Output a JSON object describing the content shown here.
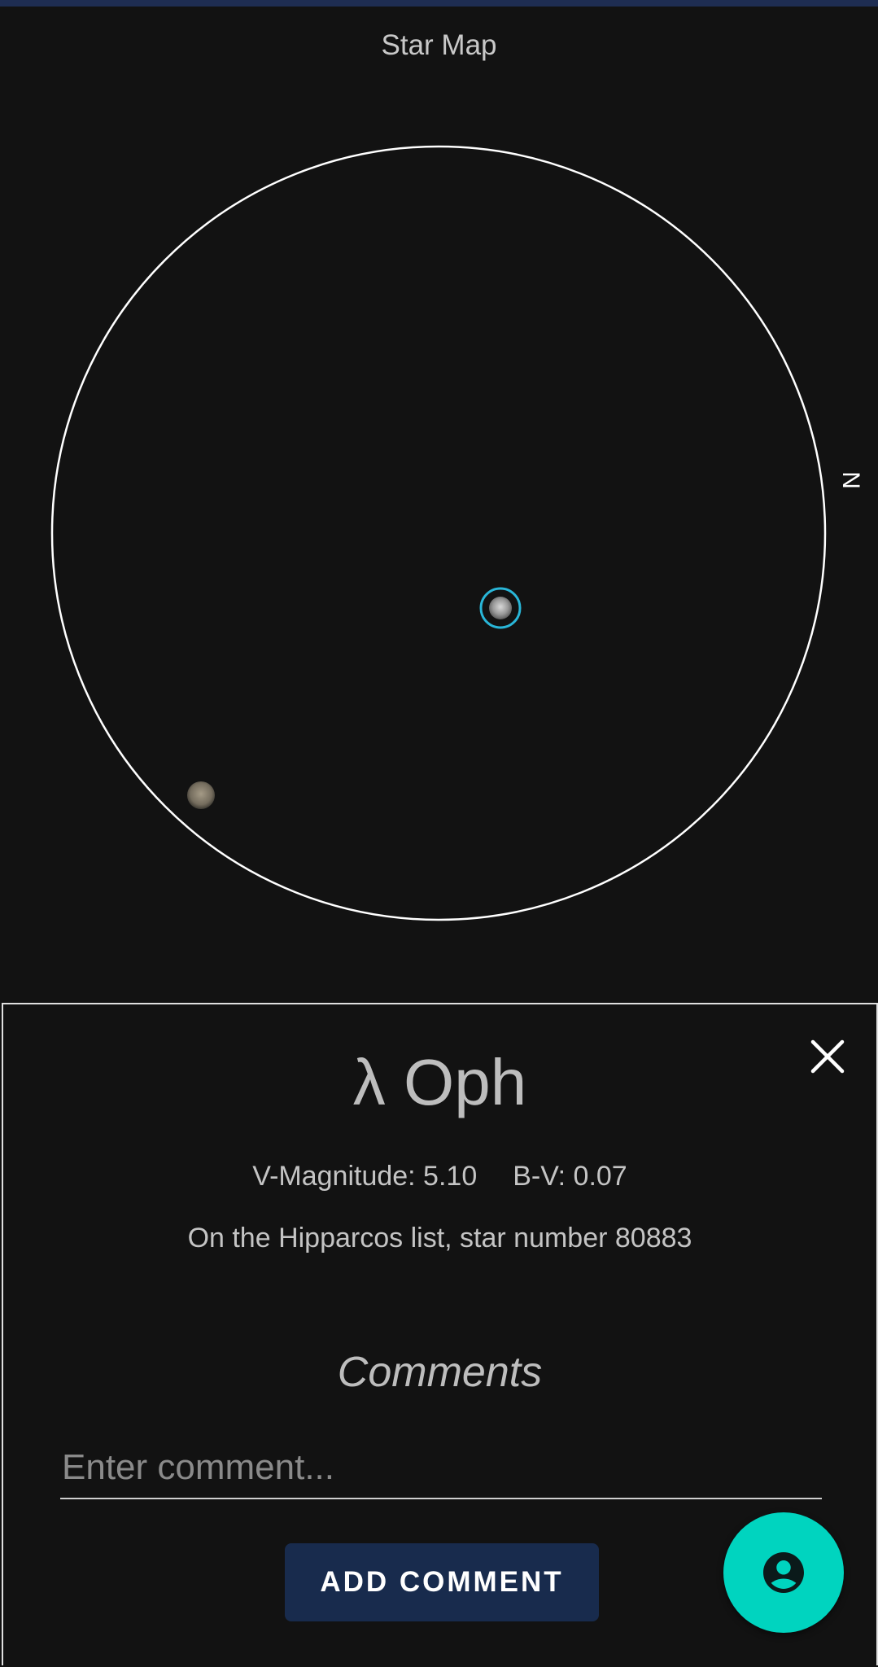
{
  "header": {
    "title": "Star Map"
  },
  "star_map": {
    "compass_label": "N",
    "circle_color": "#ffffff",
    "selected_ring_color": "#29b6d8"
  },
  "star_detail": {
    "name": "λ Oph",
    "v_magnitude": "V-Magnitude: 5.10",
    "b_v": "B-V: 0.07",
    "catalog": "On the Hipparcos list, star number 80883"
  },
  "comments": {
    "heading": "Comments",
    "placeholder": "Enter comment...",
    "value": "",
    "add_button_label": "ADD COMMENT"
  },
  "icons": {
    "close": "close-icon",
    "fab": "account-circle-icon"
  },
  "colors": {
    "background": "#121212",
    "accent_button": "#182b4d",
    "fab": "#00d4bf"
  }
}
